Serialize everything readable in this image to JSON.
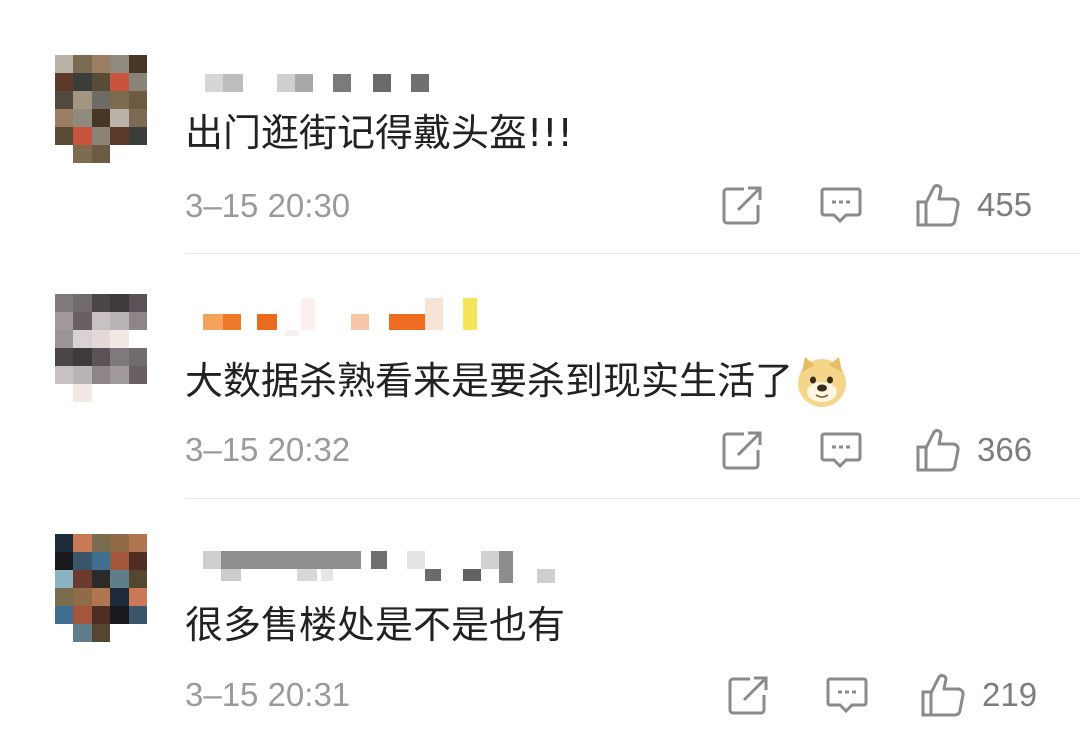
{
  "comments": [
    {
      "nickname_redacted": true,
      "text": "出门逛街记得戴头盔!!!",
      "time": "3–15 20:30",
      "likes": "455",
      "has_emoji": false,
      "avatar_palette": [
        "#b9b3a8",
        "#c9543e",
        "#a49581",
        "#7d6a52",
        "#8a8478",
        "#6e6a64",
        "#9a7f62",
        "#5d3a2a",
        "#7c6b4f",
        "#8f8a7e",
        "#3b3d3a",
        "#6c5a43",
        "#473526",
        "#5a4b37",
        "#514a3c"
      ]
    },
    {
      "nickname_redacted": true,
      "text": "大数据杀熟看来是要杀到现实生活了",
      "time": "3–15 20:32",
      "likes": "366",
      "has_emoji": true,
      "emoji_name": "doge-emoji",
      "avatar_palette": [
        "#9a9698",
        "#7e7a7c",
        "#b9b5b6",
        "#d8d2d4",
        "#6f6b6e",
        "#8d8587",
        "#e4d9d8",
        "#4c4548",
        "#a09a9c",
        "#f2e9e4",
        "#3e3a3c",
        "#6a5f63",
        "#ffffff",
        "#5a5256",
        "#c8c1c3"
      ]
    },
    {
      "nickname_redacted": true,
      "text": "很多售楼处是不是也有",
      "time": "3–15 20:31",
      "likes": "219",
      "has_emoji": false,
      "avatar_palette": [
        "#3f6f8f",
        "#8bb2c4",
        "#1d2b3a",
        "#a4563d",
        "#6b3a2e",
        "#c97956",
        "#4f2d25",
        "#2a2a2a",
        "#7a6d4f",
        "#19181c",
        "#607d8b",
        "#8f6b47",
        "#3a5568",
        "#55462f",
        "#b07650"
      ]
    }
  ],
  "actions": {
    "forward_icon": "forward-icon",
    "reply_icon": "comment-icon",
    "like_icon": "thumbs-up-icon"
  },
  "colors": {
    "text": "#222222",
    "meta": "#9a9a9a",
    "icon": "#8a8a8a",
    "divider": "#e6e6e6"
  }
}
